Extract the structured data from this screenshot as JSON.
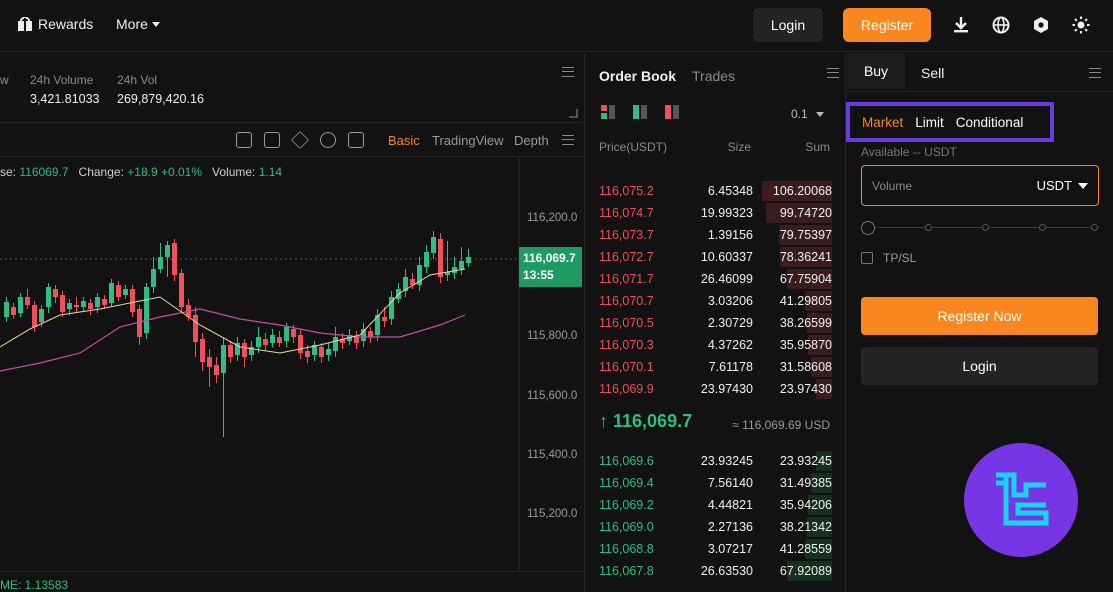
{
  "header": {
    "rewards_label": "Rewards",
    "more_label": "More",
    "login_label": "Login",
    "register_label": "Register",
    "icons": [
      "download-icon",
      "globe-icon",
      "hexagon-icon",
      "theme-icon"
    ]
  },
  "stats": {
    "cut_label": "w",
    "volume_label": "24h Volume",
    "volume_value": "3,421.81033",
    "vol_label": "24h Vol",
    "vol_value": "269,879,420.16"
  },
  "chart_toolbar": {
    "tabs": [
      "Basic",
      "TradingView",
      "Depth"
    ],
    "active_tab": "Basic"
  },
  "ohlc": {
    "close_label": "se:",
    "close_value": "116069.7",
    "change_label": "Change:",
    "change_value": "+18.9 +0.01%",
    "volume_label": "Volume:",
    "volume_value": "1.14"
  },
  "chart_data": {
    "type": "candlestick",
    "price_axis": [
      "116,200.0",
      "115,800.0",
      "115,600.0",
      "115,400.0",
      "115,200.0"
    ],
    "ylim": [
      115100,
      116330
    ],
    "last_price_tag": "116,069.7",
    "last_price_time": "13:55",
    "colors": {
      "up": "#2ebd85",
      "down": "#f0505a",
      "ma_short": "#e8d9a0",
      "ma_long": "#c24fa3"
    },
    "volume_label": "ME: 1.13583"
  },
  "order_book": {
    "tab_active": "Order Book",
    "tab_other": "Trades",
    "tick_size": "0.1",
    "col_price": "Price(USDT)",
    "col_size": "Size",
    "col_sum": "Sum",
    "asks": [
      {
        "price": "116,075.2",
        "size": "6.45348",
        "sum": "106.20068",
        "depth": 1.0
      },
      {
        "price": "116,074.7",
        "size": "19.99323",
        "sum": "99.74720",
        "depth": 0.94
      },
      {
        "price": "116,073.7",
        "size": "1.39156",
        "sum": "79.75397",
        "depth": 0.75
      },
      {
        "price": "116,072.7",
        "size": "10.60337",
        "sum": "78.36241",
        "depth": 0.74
      },
      {
        "price": "116,071.7",
        "size": "26.46099",
        "sum": "67.75904",
        "depth": 0.64
      },
      {
        "price": "116,070.7",
        "size": "3.03206",
        "sum": "41.29805",
        "depth": 0.39
      },
      {
        "price": "116,070.5",
        "size": "2.30729",
        "sum": "38.26599",
        "depth": 0.36
      },
      {
        "price": "116,070.3",
        "size": "4.37262",
        "sum": "35.95870",
        "depth": 0.34
      },
      {
        "price": "116,070.1",
        "size": "7.61178",
        "sum": "31.58608",
        "depth": 0.3
      },
      {
        "price": "116,069.9",
        "size": "23.97430",
        "sum": "23.97430",
        "depth": 0.23
      }
    ],
    "mid_price": "↑ 116,069.7",
    "mid_usd": "≈ 116,069.69 USD",
    "bids": [
      {
        "price": "116,069.6",
        "size": "23.93245",
        "sum": "23.93245",
        "depth": 0.23
      },
      {
        "price": "116,069.4",
        "size": "7.56140",
        "sum": "31.49385",
        "depth": 0.3
      },
      {
        "price": "116,069.2",
        "size": "4.44821",
        "sum": "35.94206",
        "depth": 0.34
      },
      {
        "price": "116,069.0",
        "size": "2.27136",
        "sum": "38.21342",
        "depth": 0.36
      },
      {
        "price": "116,068.8",
        "size": "3.07217",
        "sum": "41.28559",
        "depth": 0.39
      },
      {
        "price": "116,067.8",
        "size": "26.63530",
        "sum": "67.92089",
        "depth": 0.64
      }
    ]
  },
  "trade_panel": {
    "buy_label": "Buy",
    "sell_label": "Sell",
    "order_types": [
      "Market",
      "Limit",
      "Conditional"
    ],
    "active_order_type": "Market",
    "available_label": "Available -- USDT",
    "volume_placeholder": "Volume",
    "volume_unit": "USDT",
    "tpsl_label": "TP/SL",
    "register_now_label": "Register Now",
    "login_label": "Login"
  }
}
